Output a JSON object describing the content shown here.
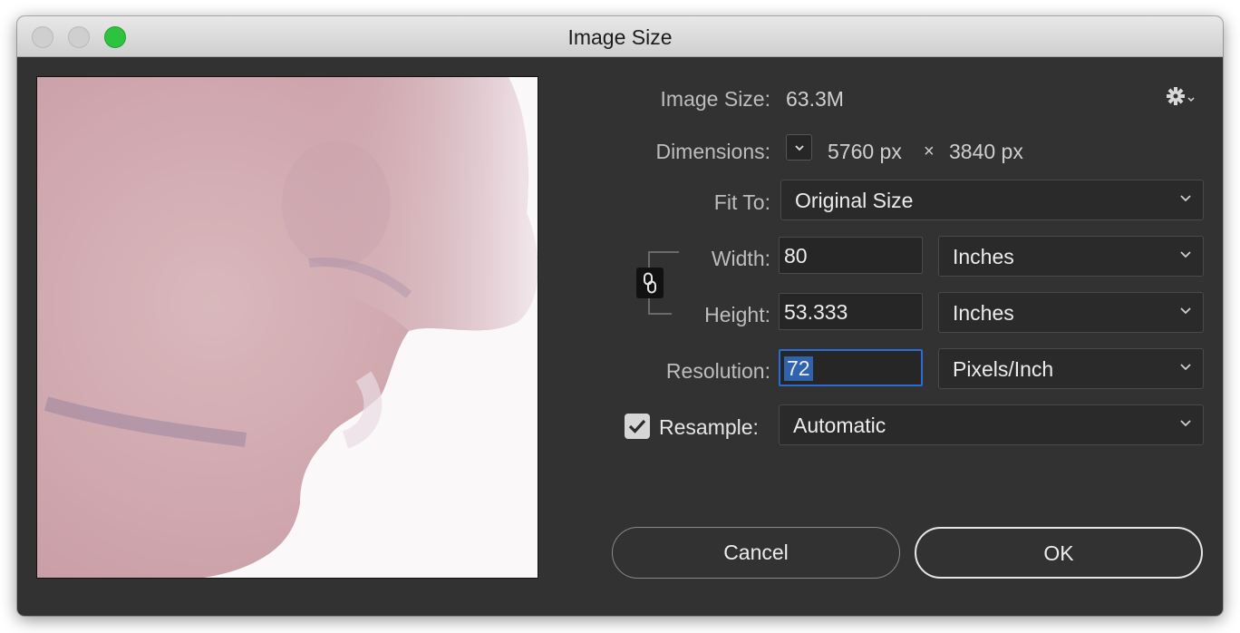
{
  "window": {
    "title": "Image Size"
  },
  "info": {
    "image_size_label": "Image Size:",
    "image_size_value": "63.3M",
    "dimensions_label": "Dimensions:",
    "dimensions_width": "5760 px",
    "dimensions_times": "×",
    "dimensions_height": "3840 px"
  },
  "fit_to": {
    "label": "Fit To:",
    "value": "Original Size"
  },
  "width": {
    "label": "Width:",
    "value": "80",
    "unit": "Inches"
  },
  "height": {
    "label": "Height:",
    "value": "53.333",
    "unit": "Inches"
  },
  "resolution": {
    "label": "Resolution:",
    "value": "72",
    "unit": "Pixels/Inch"
  },
  "resample": {
    "label": "Resample:",
    "checked": true,
    "value": "Automatic"
  },
  "buttons": {
    "cancel": "Cancel",
    "ok": "OK"
  },
  "colors": {
    "dialog_bg": "#323232",
    "focus_ring": "#2a6cd3",
    "maximize": "#2ec33f"
  },
  "icons": [
    "close-dot",
    "minimize-dot",
    "maximize-dot",
    "gear-icon",
    "chevron-down-icon",
    "link-icon",
    "checkmark-icon"
  ]
}
